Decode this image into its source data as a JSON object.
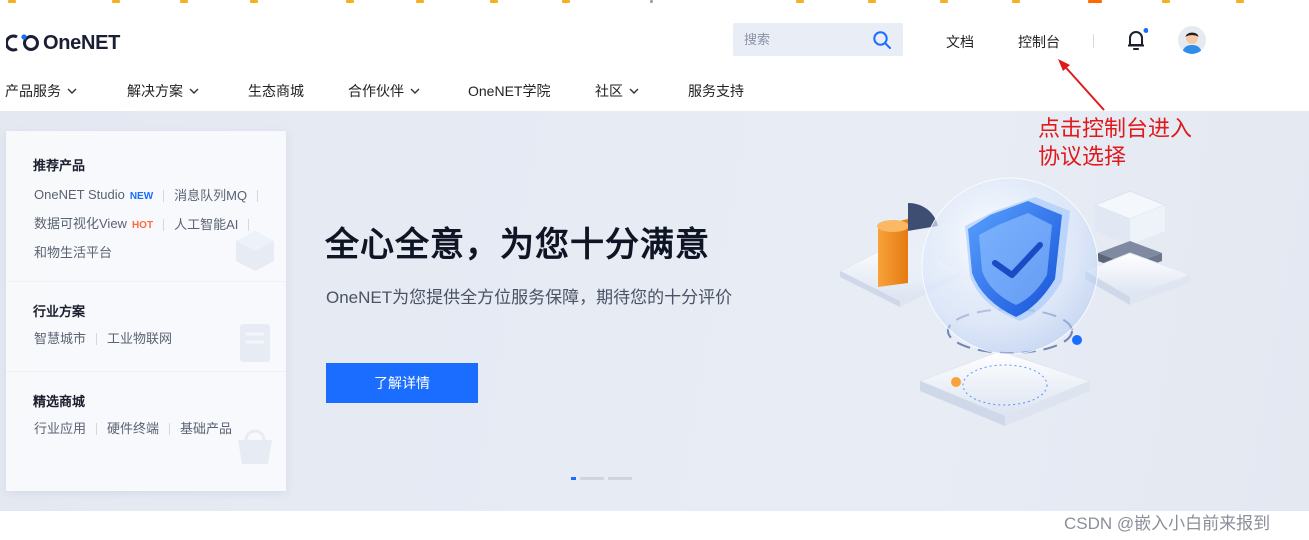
{
  "header": {
    "logo_text": "OneNET",
    "search": {
      "placeholder": "搜索"
    },
    "links": {
      "docs": "文档",
      "console": "控制台"
    },
    "colors": {
      "accent": "#1a6dff",
      "logo_blue": "#1a6dff",
      "logo_dark": "#1a1f36"
    }
  },
  "nav": {
    "items": [
      {
        "label": "产品服务",
        "dropdown": true
      },
      {
        "label": "解决方案",
        "dropdown": true
      },
      {
        "label": "生态商城",
        "dropdown": false
      },
      {
        "label": "合作伙伴",
        "dropdown": true
      },
      {
        "label": "OneNET学院",
        "dropdown": false
      },
      {
        "label": "社区",
        "dropdown": true
      },
      {
        "label": "服务支持",
        "dropdown": false
      }
    ]
  },
  "panel": {
    "recommend": {
      "title": "推荐产品",
      "items": [
        "OneNET Studio",
        "消息队列MQ",
        "数据可视化View",
        "人工智能AI",
        "和物生活平台"
      ],
      "badges": {
        "new": "NEW",
        "hot": "HOT"
      }
    },
    "industry": {
      "title": "行业方案",
      "items": [
        "智慧城市",
        "工业物联网"
      ]
    },
    "mall": {
      "title": "精选商城",
      "items": [
        "行业应用",
        "硬件终端",
        "基础产品"
      ]
    }
  },
  "hero": {
    "title": "全心全意，为您十分满意",
    "subtitle": "OneNET为您提供全方位服务保障，期待您的十分评价",
    "button": "了解详情",
    "carousel": {
      "slides": 3,
      "active": 1
    }
  },
  "annotation": {
    "line1": "点击控制台进入",
    "line2": "协议选择",
    "color": "#e01a1a"
  },
  "watermark": "CSDN @嵌入小白前来报到"
}
